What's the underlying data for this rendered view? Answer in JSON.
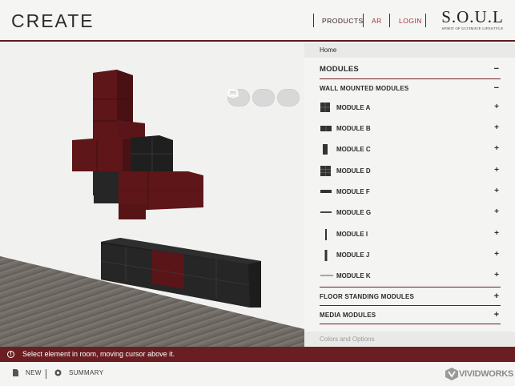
{
  "header": {
    "title": "CREATE",
    "nav": {
      "products": "PRODUCTS",
      "ar": "AR",
      "login": "LOGIN"
    },
    "logo": {
      "main": "S.O.U.L",
      "sub": "SPIRIT OF ULTIMATE LIFESTYLE"
    }
  },
  "viewport": {
    "tools": [
      "rotate-view-icon",
      "front-view-icon",
      "box-view-icon"
    ],
    "colors": {
      "module_red": "#5a1518",
      "module_black": "#232323",
      "floor": "#6e6862",
      "wall": "#f1f1ef"
    }
  },
  "panel": {
    "breadcrumb": "Home",
    "modules": {
      "title": "MODULES",
      "toggle": "−"
    },
    "wall_mounted": {
      "title": "WALL MOUNTED MODULES",
      "toggle": "−"
    },
    "items": [
      {
        "label": "MODULE A",
        "icon": "module-a-icon"
      },
      {
        "label": "MODULE B",
        "icon": "module-b-icon"
      },
      {
        "label": "MODULE C",
        "icon": "module-c-icon"
      },
      {
        "label": "MODULE D",
        "icon": "module-d-icon"
      },
      {
        "label": "MODULE F",
        "icon": "module-f-icon"
      },
      {
        "label": "MODULE G",
        "icon": "module-g-icon"
      },
      {
        "label": "MODULE I",
        "icon": "module-i-icon"
      },
      {
        "label": "MODULE J",
        "icon": "module-j-icon"
      },
      {
        "label": "MODULE K",
        "icon": "module-k-icon"
      }
    ],
    "plus": "+",
    "floor_standing": {
      "title": "FLOOR STANDING MODULES",
      "toggle": "+"
    },
    "media": {
      "title": "MEDIA MODULES",
      "toggle": "+"
    },
    "colors_options": "Colors and Options"
  },
  "status": {
    "text": "Select element in room, moving cursor above it."
  },
  "bottom": {
    "new": "NEW",
    "summary": "SUMMARY",
    "brand": "VIVIDWORKS"
  },
  "colors": {
    "accent": "#6b1e22",
    "nav_link": "#a0343a"
  }
}
